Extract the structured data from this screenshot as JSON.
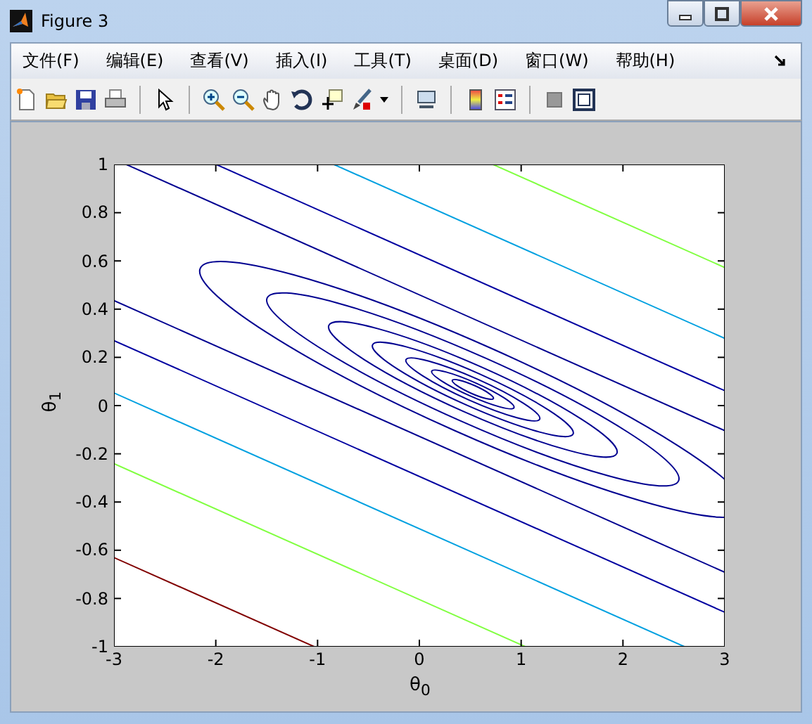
{
  "window": {
    "title": "Figure 3"
  },
  "menu": [
    "文件(F)",
    "编辑(E)",
    "查看(V)",
    "插入(I)",
    "工具(T)",
    "桌面(D)",
    "窗口(W)",
    "帮助(H)"
  ],
  "axes": {
    "xlabel": "θ$_{0}$",
    "ylabel": "θ$_{1}$",
    "xticks": [
      "-3",
      "-2",
      "-1",
      "0",
      "1",
      "2",
      "3"
    ],
    "yticks": [
      "1",
      "0.8",
      "0.6",
      "0.4",
      "0.2",
      "0",
      "-0.2",
      "-0.4",
      "-0.6",
      "-0.8",
      "-1"
    ]
  }
}
